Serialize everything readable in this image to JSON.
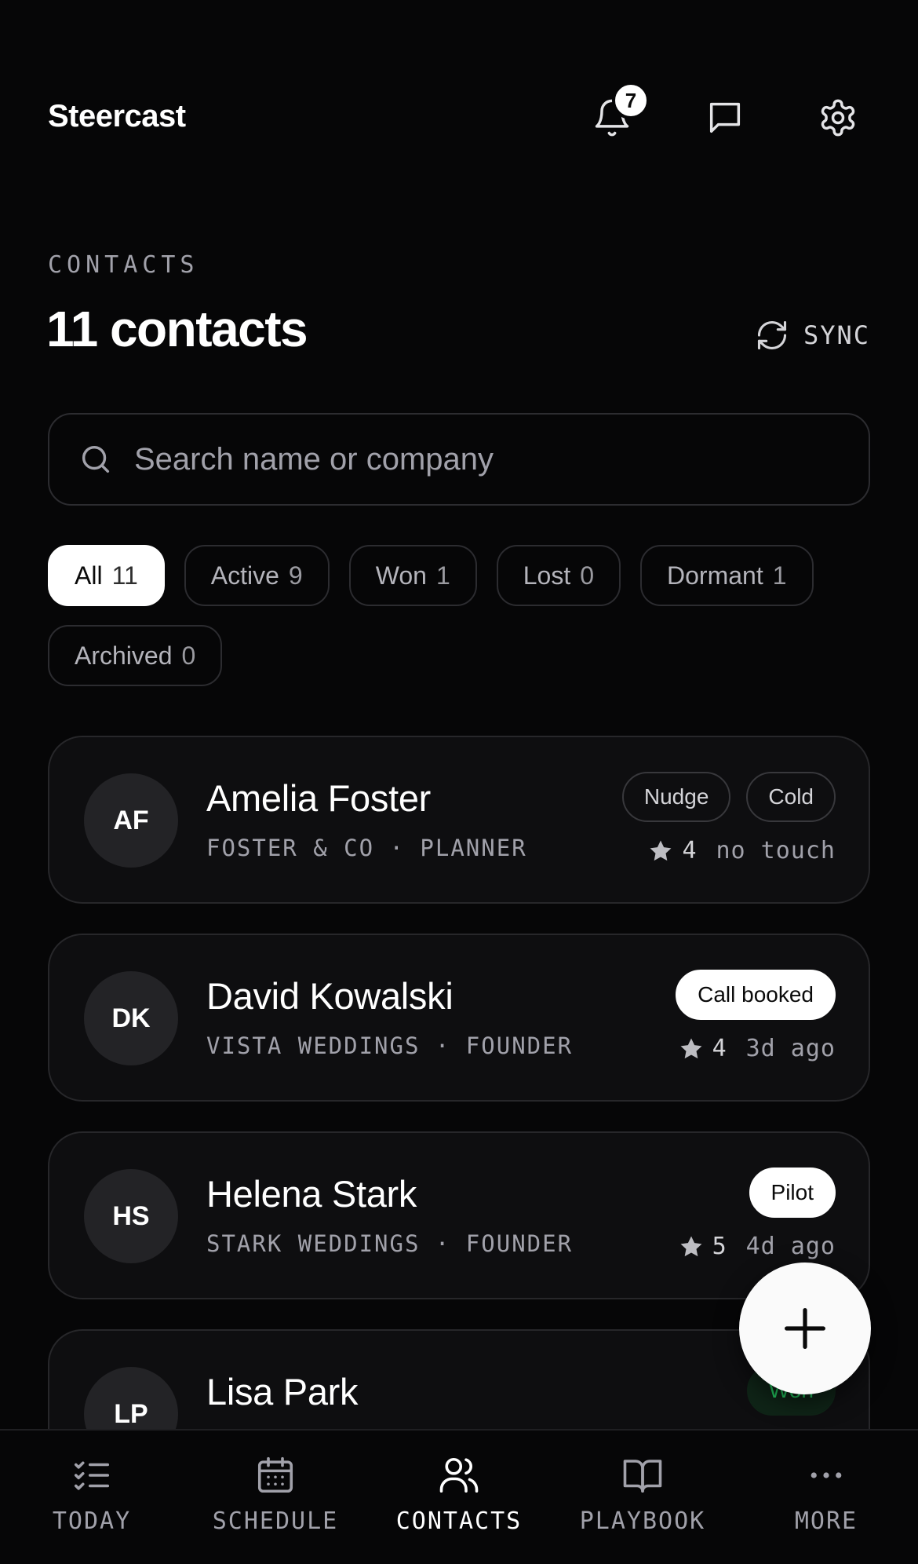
{
  "header": {
    "brand": "Steercast",
    "notification_count": "7"
  },
  "section_label": "CONTACTS",
  "count_title": "11 contacts",
  "sync_label": "SYNC",
  "search": {
    "placeholder": "Search name or company"
  },
  "filters": [
    {
      "label": "All",
      "count": "11",
      "active": true
    },
    {
      "label": "Active",
      "count": "9",
      "active": false
    },
    {
      "label": "Won",
      "count": "1",
      "active": false
    },
    {
      "label": "Lost",
      "count": "0",
      "active": false
    },
    {
      "label": "Dormant",
      "count": "1",
      "active": false
    },
    {
      "label": "Archived",
      "count": "0",
      "active": false
    }
  ],
  "contacts": [
    {
      "initials": "AF",
      "name": "Amelia Foster",
      "meta": "FOSTER & CO · PLANNER",
      "tags": [
        "Nudge",
        "Cold"
      ],
      "rating": "4",
      "last": "no touch"
    },
    {
      "initials": "DK",
      "name": "David Kowalski",
      "meta": "VISTA WEDDINGS · FOUNDER",
      "tags": [
        "Call booked"
      ],
      "rating": "4",
      "last": "3d ago"
    },
    {
      "initials": "HS",
      "name": "Helena Stark",
      "meta": "STARK WEDDINGS · FOUNDER",
      "tags": [
        "Pilot"
      ],
      "rating": "5",
      "last": "4d ago"
    },
    {
      "initials": "LP",
      "name": "Lisa Park",
      "meta": "",
      "tags": [
        "Won"
      ],
      "rating": "",
      "last": ""
    }
  ],
  "nav": {
    "today": "TODAY",
    "schedule": "SCHEDULE",
    "contacts": "CONTACTS",
    "playbook": "PLAYBOOK",
    "more": "MORE"
  },
  "icons": {
    "notifications": "bell-icon",
    "messages": "chat-icon",
    "settings": "gear-icon",
    "sync": "refresh-icon",
    "search": "search-icon",
    "rating": "star-icon",
    "fab": "plus-icon"
  },
  "colors": {
    "background": "#060607",
    "card": "#0e0e10",
    "accent": "#ffffff",
    "won": "#22c55e"
  }
}
